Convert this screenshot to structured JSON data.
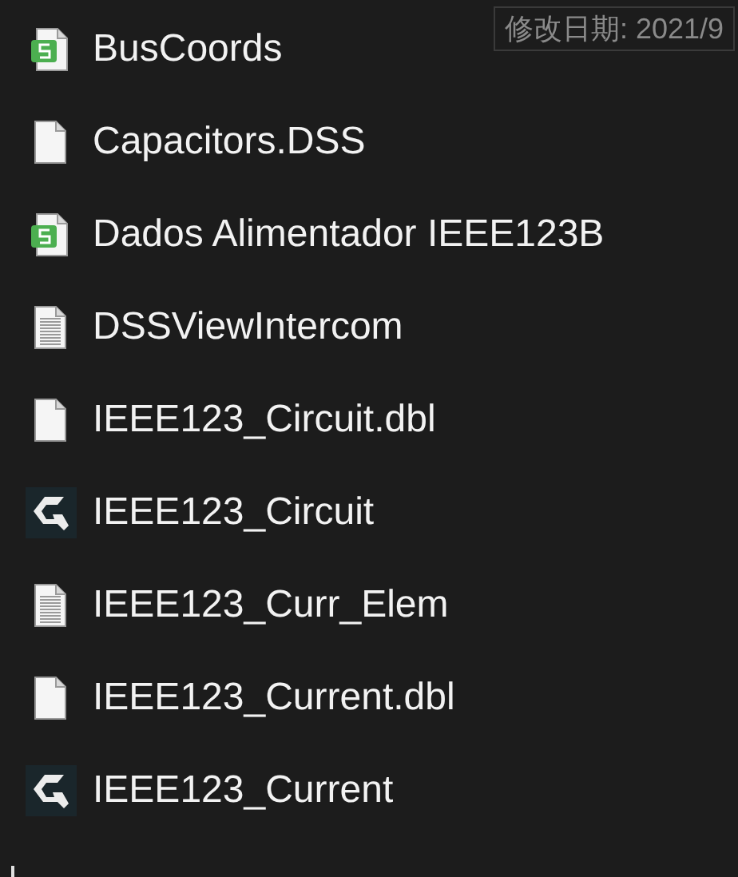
{
  "files": [
    {
      "name": "BusCoords",
      "kind": "sheet"
    },
    {
      "name": "Capacitors.DSS",
      "kind": "blank"
    },
    {
      "name": "Dados Alimentador IEEE123B",
      "kind": "sheet"
    },
    {
      "name": "DSSViewIntercom",
      "kind": "text"
    },
    {
      "name": "IEEE123_Circuit.dbl",
      "kind": "blank"
    },
    {
      "name": "IEEE123_Circuit",
      "kind": "app"
    },
    {
      "name": "IEEE123_Curr_Elem",
      "kind": "text"
    },
    {
      "name": "IEEE123_Current.dbl",
      "kind": "blank"
    },
    {
      "name": "IEEE123_Current",
      "kind": "app"
    }
  ],
  "tooltip": {
    "text": "修改日期: 2021/9"
  }
}
